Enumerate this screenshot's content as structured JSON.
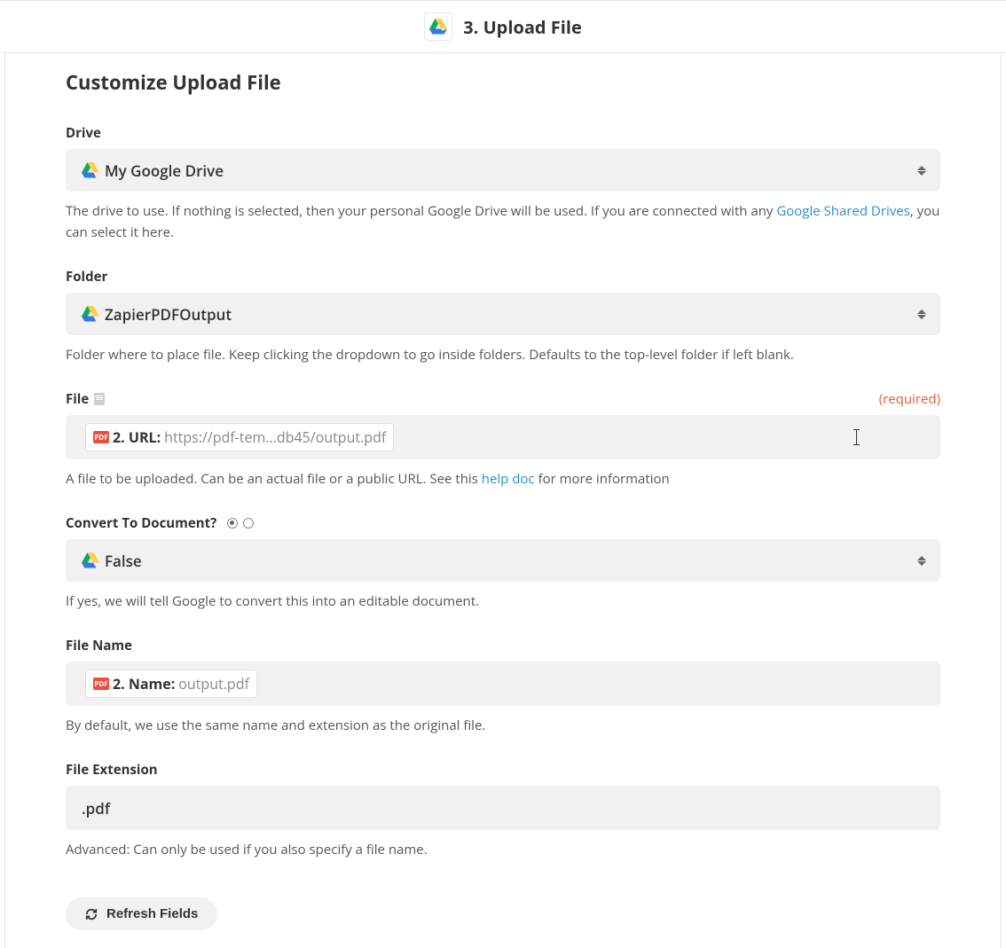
{
  "header": {
    "title": "3. Upload File",
    "app_icon": "google-drive"
  },
  "section_title": "Customize Upload File",
  "fields": {
    "drive": {
      "label": "Drive",
      "value": "My Google Drive",
      "help_prefix": "The drive to use. If nothing is selected, then your personal Google Drive will be used. If you are connected with any ",
      "help_link_text": "Google Shared Drives",
      "help_suffix": ", you can select it here."
    },
    "folder": {
      "label": "Folder",
      "value": "ZapierPDFOutput",
      "help": "Folder where to place file. Keep clicking the dropdown to go inside folders. Defaults to the top-level folder if left blank."
    },
    "file": {
      "label": "File",
      "required_label": "(required)",
      "pill_badge": "PDF",
      "pill_key": "2. URL:",
      "pill_val": "https://pdf-tem...db45/output.pdf",
      "help_prefix": "A file to be uploaded. Can be an actual file or a public URL. See this ",
      "help_link_text": "help doc",
      "help_suffix": " for more information"
    },
    "convert": {
      "label": "Convert To Document?",
      "value": "False",
      "help": "If yes, we will tell Google to convert this into an editable document."
    },
    "filename": {
      "label": "File Name",
      "pill_badge": "PDF",
      "pill_key": "2. Name:",
      "pill_val": "output.pdf",
      "help": "By default, we use the same name and extension as the original file."
    },
    "extension": {
      "label": "File Extension",
      "value": ".pdf",
      "help": "Advanced: Can only be used if you also specify a file name."
    }
  },
  "buttons": {
    "refresh": "Refresh Fields"
  }
}
